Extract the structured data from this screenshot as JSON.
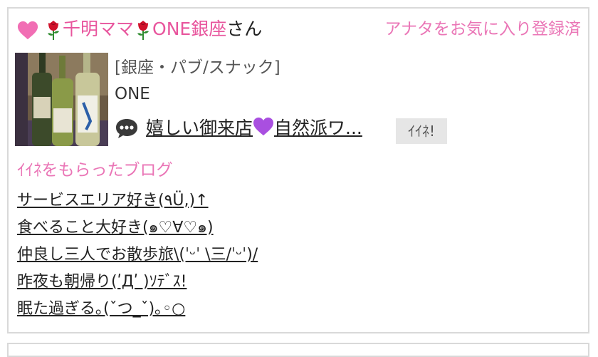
{
  "profile": {
    "name_prefix": "千明ママ",
    "name_shop": "ONE銀座",
    "name_suffix": "さん",
    "favorite_label": "アナタをお気に入り登録済"
  },
  "shop": {
    "category": "[銀座・パブ/スナック]",
    "name": "ONE"
  },
  "post": {
    "title_start": "嬉しい御来店",
    "title_end": "自然派ワ...",
    "like_label": "ｲｲﾈ!"
  },
  "liked_blogs": {
    "title": "ｲｲﾈをもらったブログ",
    "items": [
      "サービスエリア好き(٩Ü,)↑",
      "食べること大好き(๑♡∀♡๑)",
      "仲良し三人でお散歩旅\\(ˈᵕˈ \\三/ˈᵕˈ)/",
      "昨夜も朝帰り(ʹДʹ )ｿﾃﾞｽ!",
      "眠た過ぎる｡(ˇつ_ˇ)｡◦○"
    ]
  },
  "colors": {
    "accent_pink": "#ea75b6",
    "name_pink": "#e8559d",
    "heart_purple": "#9b3fd6"
  }
}
